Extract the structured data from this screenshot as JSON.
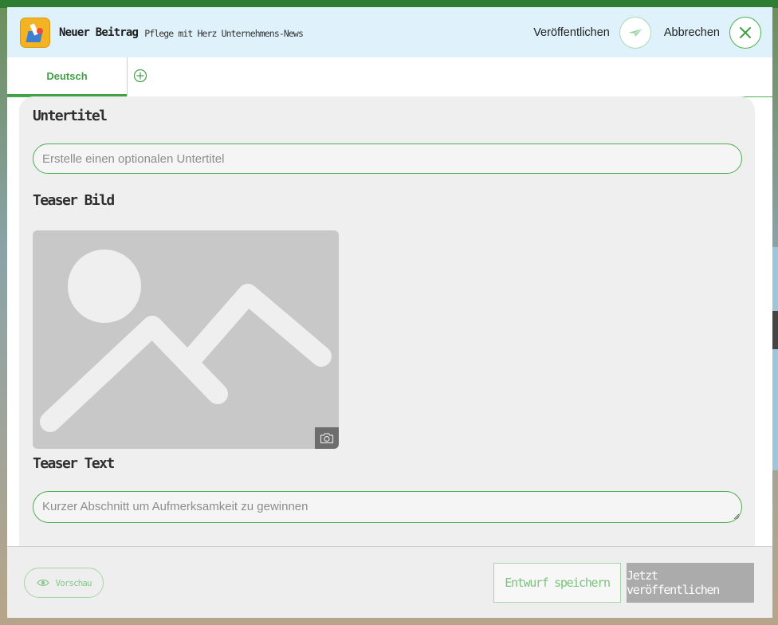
{
  "header": {
    "title": "Neuer Beitrag",
    "subtitle": "Pflege mit Herz Unternehmens-News",
    "publish_label": "Veröffentlichen",
    "cancel_label": "Abbrechen",
    "app_icon": "megaphone-app-icon",
    "publish_icon": "paper-plane-icon",
    "cancel_icon": "close-icon"
  },
  "tabs": {
    "active_label": "Deutsch",
    "add_icon": "plus-circle-icon"
  },
  "form": {
    "subtitle_label": "Untertitel",
    "subtitle_placeholder": "Erstelle einen optionalen Untertitel",
    "teaser_image_label": "Teaser Bild",
    "teaser_image_icon": "image-placeholder-icon",
    "camera_icon": "camera-icon",
    "teaser_text_label": "Teaser Text",
    "teaser_text_placeholder": "Kurzer Abschnitt um Aufmerksamkeit zu gewinnen"
  },
  "footer": {
    "preview_label": "Vorschau",
    "preview_icon": "eye-icon",
    "draft_label": "Entwurf speichern",
    "publish_now_label": "Jetzt veröffentlichen"
  },
  "colors": {
    "accent": "#43a047",
    "header_bg": "#dff2fb",
    "disabled_button": "#ababab"
  }
}
